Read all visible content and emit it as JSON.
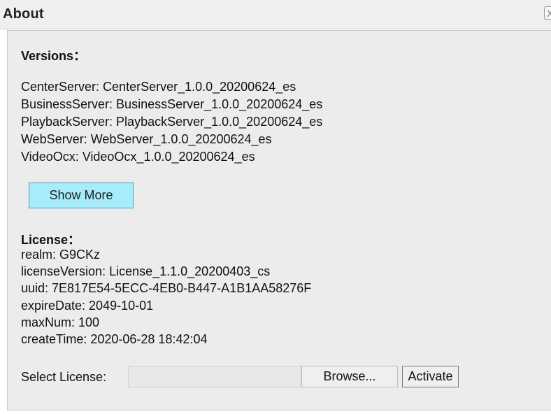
{
  "window": {
    "title": "About",
    "close_glyph": "X"
  },
  "versions": {
    "heading": "Versions：",
    "lines": [
      "CenterServer: CenterServer_1.0.0_20200624_es",
      "BusinessServer: BusinessServer_1.0.0_20200624_es",
      "PlaybackServer: PlaybackServer_1.0.0_20200624_es",
      "WebServer: WebServer_1.0.0_20200624_es",
      "VideoOcx: VideoOcx_1.0.0_20200624_es"
    ],
    "show_more_label": "Show More"
  },
  "license": {
    "heading": "License：",
    "lines": [
      "realm: G9CKz",
      "licenseVersion: License_1.1.0_20200403_cs",
      "uuid: 7E817E54-5ECC-4EB0-B447-A1B1AA58276F",
      "expireDate: 2049-10-01",
      "maxNum: 100",
      "createTime: 2020-06-28 18:42:04"
    ]
  },
  "select_license": {
    "label": "Select License:",
    "value": "",
    "browse_label": "Browse...",
    "activate_label": "Activate"
  },
  "colors": {
    "show_more_bg": "#a6ecfb",
    "show_more_border": "#41a3be",
    "panel_bg": "#ececec"
  }
}
